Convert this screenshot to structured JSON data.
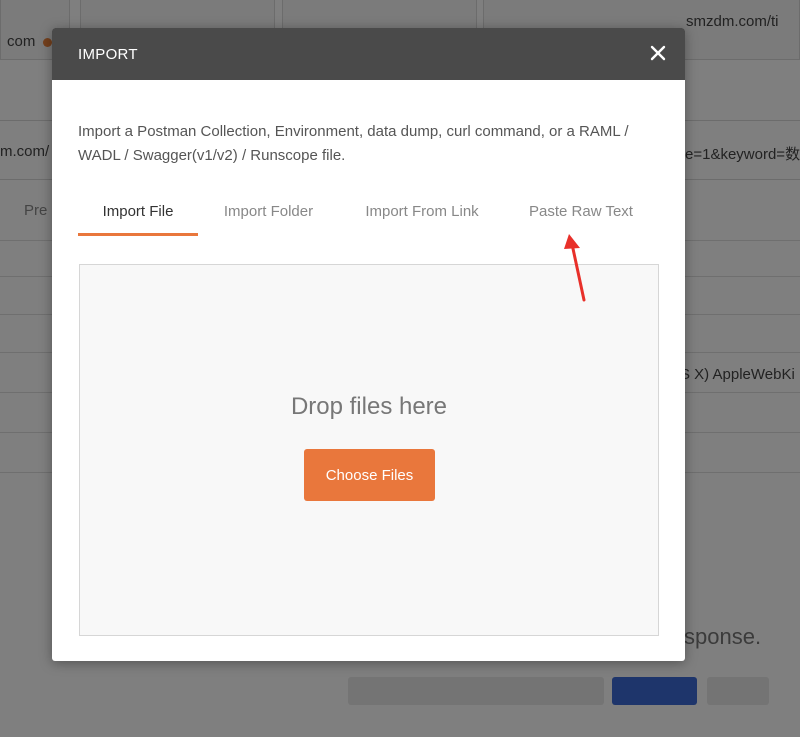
{
  "background": {
    "tabs": [
      "com",
      "",
      "",
      "smzdm.com/ti"
    ],
    "url_left": "m.com/",
    "url_right": "e=1&keyword=数",
    "side_label": "Pre",
    "user_agent_fragment": "S X) AppleWebKi",
    "response_fragment": "sponse."
  },
  "modal": {
    "title": "IMPORT",
    "description": "Import a Postman Collection, Environment, data dump, curl command, or a RAML / WADL / Swagger(v1/v2) / Runscope file.",
    "tabs": [
      {
        "label": "Import File",
        "active": true
      },
      {
        "label": "Import Folder",
        "active": false
      },
      {
        "label": "Import From Link",
        "active": false
      },
      {
        "label": "Paste Raw Text",
        "active": false
      }
    ],
    "dropzone": {
      "text": "Drop files here",
      "button_label": "Choose Files"
    }
  },
  "colors": {
    "accent": "#e9773c",
    "header": "#4a4a4a",
    "annotation_arrow": "#e8302a"
  },
  "icons": {
    "close": "close-icon",
    "annotation": "red-arrow-annotation"
  }
}
